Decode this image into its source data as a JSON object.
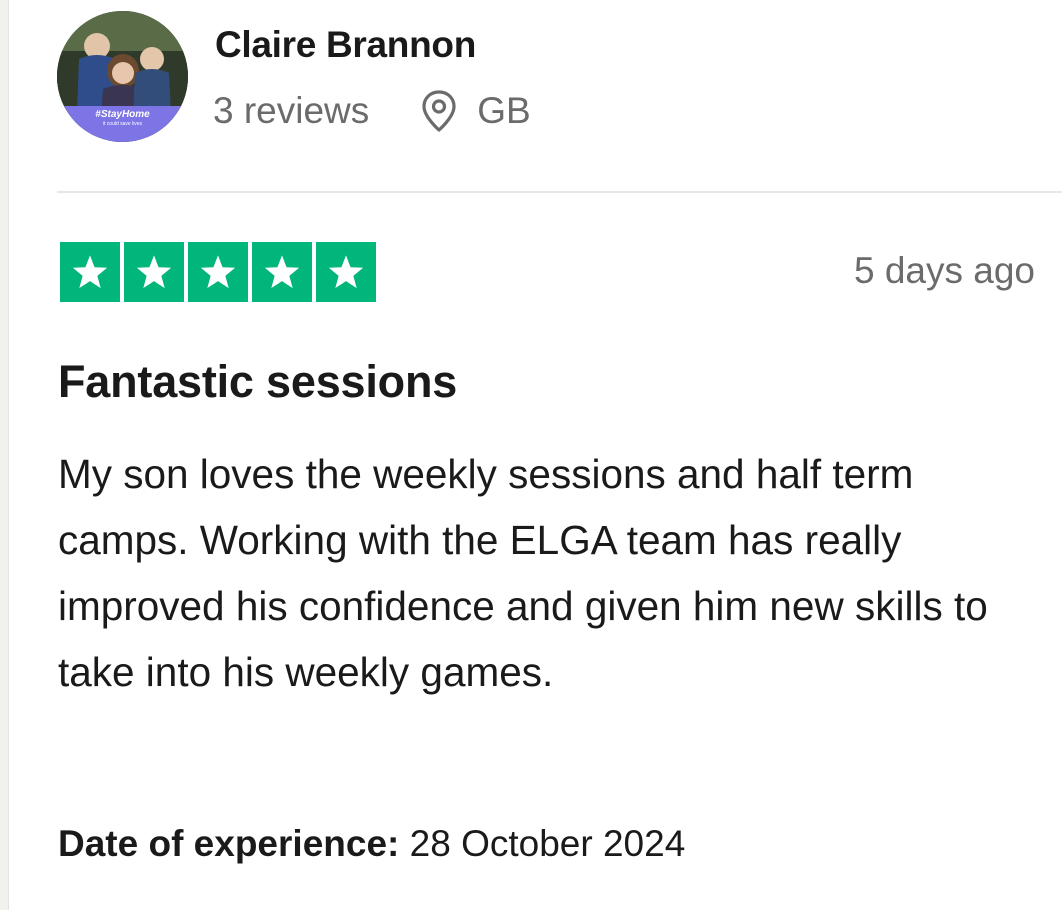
{
  "reviewer": {
    "name": "Claire Brannon",
    "reviews_count": "3 reviews",
    "country": "GB",
    "avatar_badge": "#StayHome",
    "avatar_badge_sub": "it could save lives"
  },
  "review": {
    "rating": 5,
    "max_rating": 5,
    "date": "5 days ago",
    "title": "Fantastic sessions",
    "body": "My son loves the weekly sessions and half term camps. Working with the ELGA team has really improved his confidence and given him new skills to take into his weekly games.",
    "experience_label": "Date of experience:",
    "experience_date": "28 October 2024"
  },
  "icons": {
    "location": "location-pin-icon",
    "star": "star-icon"
  },
  "colors": {
    "star_green": "#00b67a",
    "text_primary": "#1a1a1a",
    "text_secondary": "#6b6b6b",
    "badge_purple": "#7d74e6",
    "divider": "#e7e7e5"
  }
}
